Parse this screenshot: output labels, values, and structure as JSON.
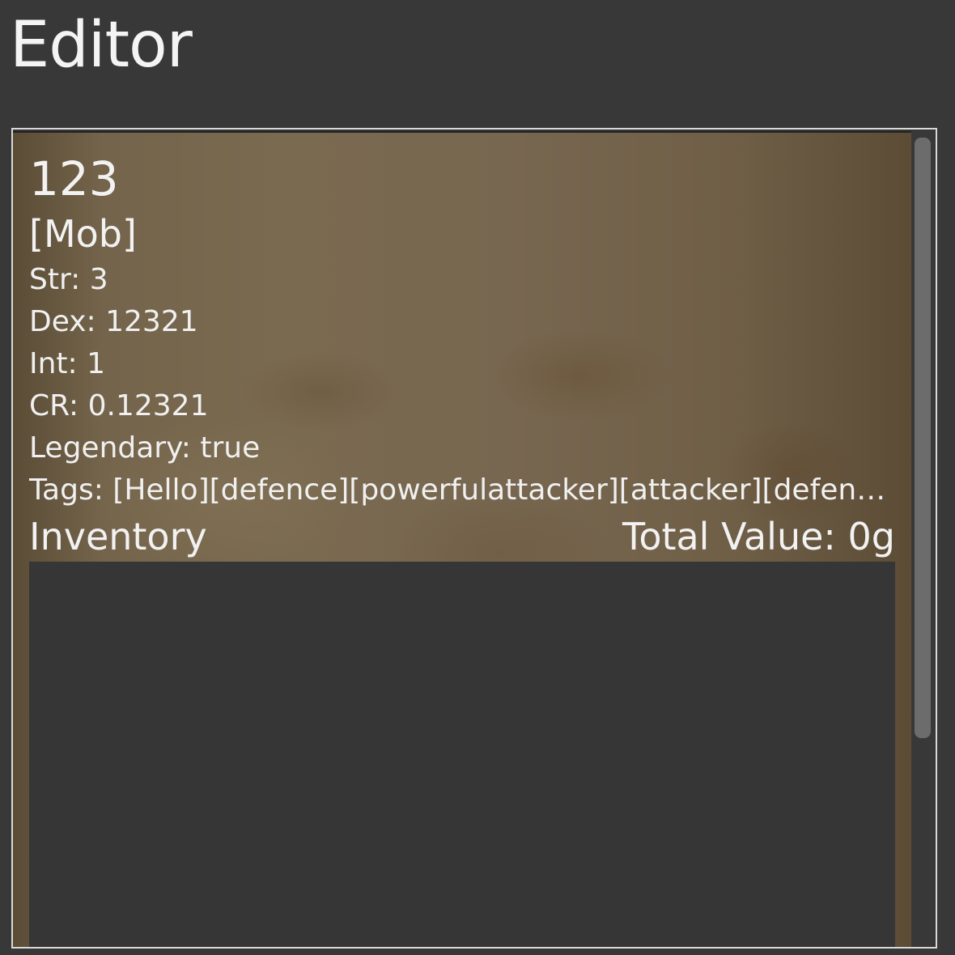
{
  "app": {
    "title": "Editor"
  },
  "card": {
    "name": "123",
    "type": "[Mob]",
    "stats": {
      "str": "Str: 3",
      "dex": "Dex: 12321",
      "int": "Int: 1",
      "cr": "CR: 0.12321",
      "legendary": "Legendary: true",
      "tags": "Tags: [Hello][defence][powerfulattacker][attacker][defender][..."
    },
    "inventory": {
      "label": "Inventory",
      "total_value": "Total Value: 0g",
      "items": []
    }
  }
}
